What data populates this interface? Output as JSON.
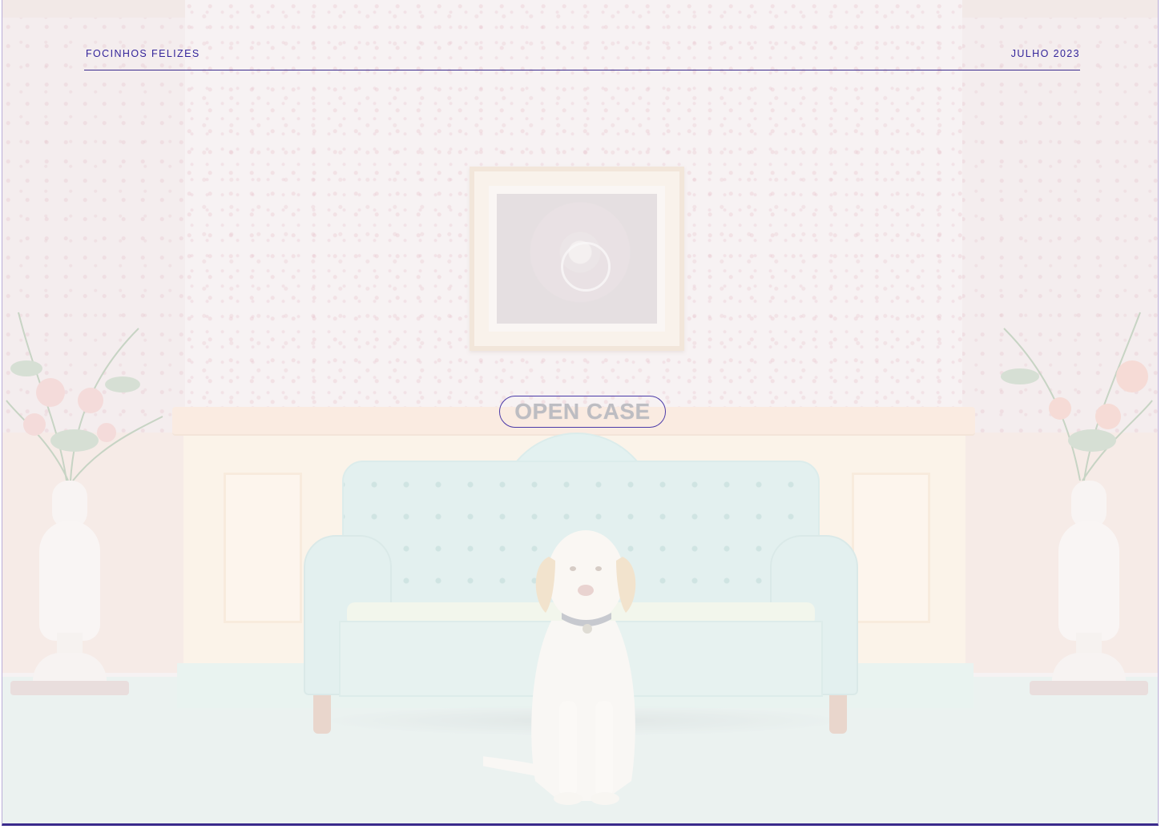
{
  "header": {
    "brand": "FOCINHOS FELIZES",
    "date": "JULHO 2023"
  },
  "cta": {
    "label": "OPEN CASE"
  },
  "colors": {
    "accent": "#33249a",
    "rule": "#3a2a8c",
    "cta_text": "#bdbdc2"
  }
}
